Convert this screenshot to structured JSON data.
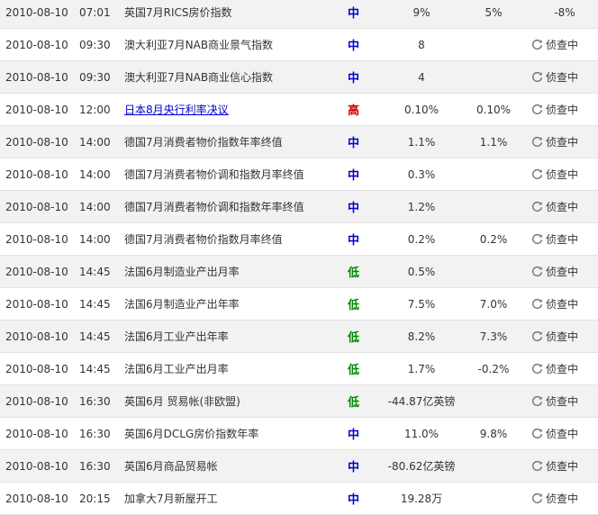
{
  "rows": [
    {
      "date": "2010-08-10",
      "time": "07:01",
      "event": "英国7月RICS房价指数",
      "importance": "中",
      "imp_level": "mid",
      "actual": "9%",
      "forecast": "5%",
      "previous": "-8%",
      "link": false,
      "pending": false
    },
    {
      "date": "2010-08-10",
      "time": "09:30",
      "event": "澳大利亚7月NAB商业景气指数",
      "importance": "中",
      "imp_level": "mid",
      "actual": "8",
      "forecast": "",
      "previous": "侦查中",
      "link": false,
      "pending": true
    },
    {
      "date": "2010-08-10",
      "time": "09:30",
      "event": "澳大利亚7月NAB商业信心指数",
      "importance": "中",
      "imp_level": "mid",
      "actual": "4",
      "forecast": "",
      "previous": "侦查中",
      "link": false,
      "pending": true
    },
    {
      "date": "2010-08-10",
      "time": "12:00",
      "event": "日本8月央行利率决议",
      "importance": "高",
      "imp_level": "high",
      "actual": "0.10%",
      "forecast": "0.10%",
      "previous": "侦查中",
      "link": true,
      "pending": true
    },
    {
      "date": "2010-08-10",
      "time": "14:00",
      "event": "德国7月消费者物价指数年率终值",
      "importance": "中",
      "imp_level": "mid",
      "actual": "1.1%",
      "forecast": "1.1%",
      "previous": "侦查中",
      "link": false,
      "pending": true
    },
    {
      "date": "2010-08-10",
      "time": "14:00",
      "event": "德国7月消费者物价调和指数月率终值",
      "importance": "中",
      "imp_level": "mid",
      "actual": "0.3%",
      "forecast": "",
      "previous": "侦查中",
      "link": false,
      "pending": true
    },
    {
      "date": "2010-08-10",
      "time": "14:00",
      "event": "德国7月消费者物价调和指数年率终值",
      "importance": "中",
      "imp_level": "mid",
      "actual": "1.2%",
      "forecast": "",
      "previous": "侦查中",
      "link": false,
      "pending": true
    },
    {
      "date": "2010-08-10",
      "time": "14:00",
      "event": "德国7月消费者物价指数月率终值",
      "importance": "中",
      "imp_level": "mid",
      "actual": "0.2%",
      "forecast": "0.2%",
      "previous": "侦查中",
      "link": false,
      "pending": true
    },
    {
      "date": "2010-08-10",
      "time": "14:45",
      "event": "法国6月制造业产出月率",
      "importance": "低",
      "imp_level": "low",
      "actual": "0.5%",
      "forecast": "",
      "previous": "侦查中",
      "link": false,
      "pending": true
    },
    {
      "date": "2010-08-10",
      "time": "14:45",
      "event": "法国6月制造业产出年率",
      "importance": "低",
      "imp_level": "low",
      "actual": "7.5%",
      "forecast": "7.0%",
      "previous": "侦查中",
      "link": false,
      "pending": true
    },
    {
      "date": "2010-08-10",
      "time": "14:45",
      "event": "法国6月工业产出年率",
      "importance": "低",
      "imp_level": "low",
      "actual": "8.2%",
      "forecast": "7.3%",
      "previous": "侦查中",
      "link": false,
      "pending": true
    },
    {
      "date": "2010-08-10",
      "time": "14:45",
      "event": "法国6月工业产出月率",
      "importance": "低",
      "imp_level": "low",
      "actual": "1.7%",
      "forecast": "-0.2%",
      "previous": "侦查中",
      "link": false,
      "pending": true
    },
    {
      "date": "2010-08-10",
      "time": "16:30",
      "event": "英国6月 贸易帐(非欧盟)",
      "importance": "低",
      "imp_level": "low",
      "actual": "-44.87亿英镑",
      "forecast": "",
      "previous": "侦查中",
      "link": false,
      "pending": true
    },
    {
      "date": "2010-08-10",
      "time": "16:30",
      "event": "英国6月DCLG房价指数年率",
      "importance": "中",
      "imp_level": "mid",
      "actual": "11.0%",
      "forecast": "9.8%",
      "previous": "侦查中",
      "link": false,
      "pending": true
    },
    {
      "date": "2010-08-10",
      "time": "16:30",
      "event": "英国6月商品贸易帐",
      "importance": "中",
      "imp_level": "mid",
      "actual": "-80.62亿英镑",
      "forecast": "",
      "previous": "侦查中",
      "link": false,
      "pending": true
    },
    {
      "date": "2010-08-10",
      "time": "20:15",
      "event": "加拿大7月新屋开工",
      "importance": "中",
      "imp_level": "mid",
      "actual": "19.28万",
      "forecast": "",
      "previous": "侦查中",
      "link": false,
      "pending": true
    }
  ],
  "colors": {
    "imp_mid": "#0000cc",
    "imp_high": "#cc0000",
    "imp_low": "#008800",
    "link": "#0000cc",
    "row_alt": "#f2f2f2"
  },
  "icons": {
    "pending": "refresh-icon"
  }
}
